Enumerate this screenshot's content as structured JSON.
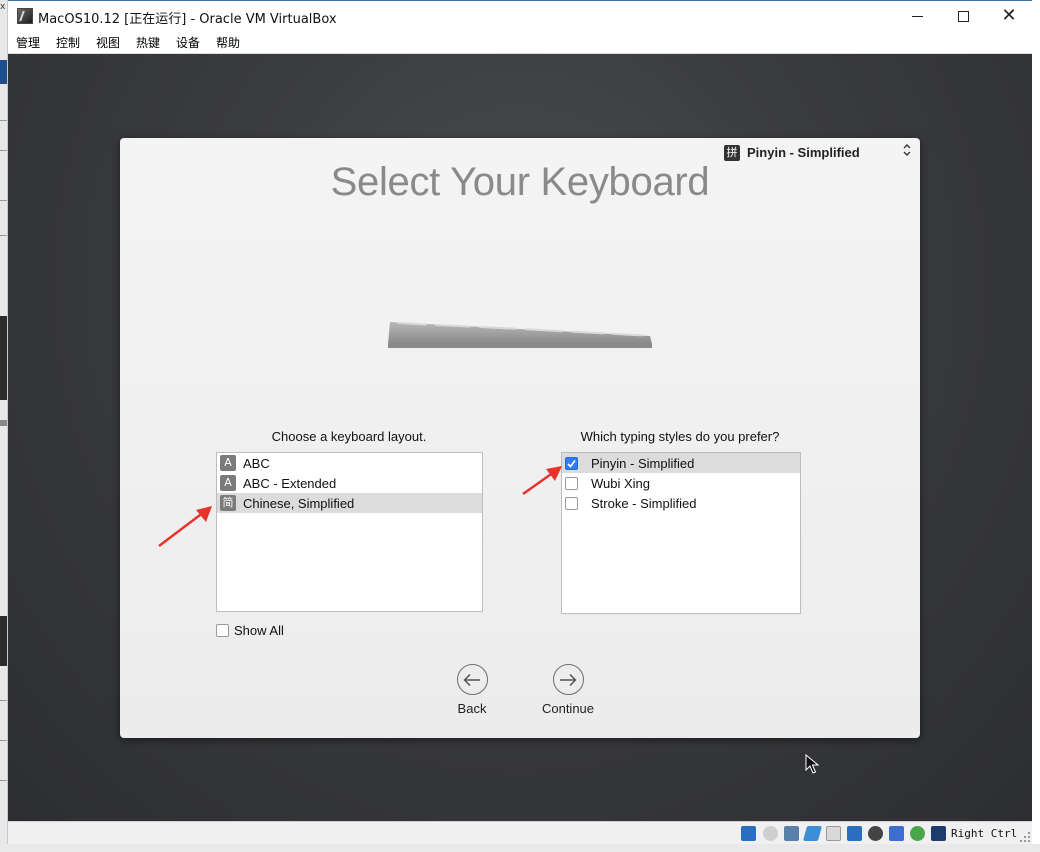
{
  "window": {
    "title": "MacOS10.12 [正在运行] - Oracle VM VirtualBox"
  },
  "menu": [
    "管理",
    "控制",
    "视图",
    "热键",
    "设备",
    "帮助"
  ],
  "input_source": {
    "icon_glyph": "拼",
    "label": "Pinyin - Simplified"
  },
  "setup": {
    "title": "Select Your Keyboard",
    "layout_caption": "Choose a keyboard layout.",
    "layouts": [
      {
        "icon": "A",
        "label": "ABC",
        "selected": false
      },
      {
        "icon": "A",
        "label": "ABC - Extended",
        "selected": false
      },
      {
        "icon": "简",
        "label": "Chinese, Simplified",
        "selected": true
      }
    ],
    "show_all_label": "Show All",
    "show_all_checked": false,
    "styles_caption": "Which typing styles do you prefer?",
    "styles": [
      {
        "label": "Pinyin - Simplified",
        "checked": true,
        "selected": true
      },
      {
        "label": "Wubi Xing",
        "checked": false,
        "selected": false
      },
      {
        "label": "Stroke - Simplified",
        "checked": false,
        "selected": false
      }
    ],
    "back_label": "Back",
    "continue_label": "Continue"
  },
  "statusbar": {
    "host_key": "Right Ctrl"
  },
  "colors": {
    "accent": "#2f7df6",
    "annotation_arrow": "#e8322c",
    "vm_background": "#3a3b3e"
  }
}
